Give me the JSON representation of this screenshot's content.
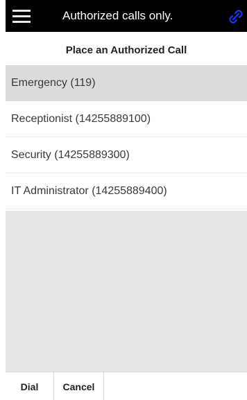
{
  "topbar": {
    "title": "Authorized calls only.",
    "menu_icon": "hamburger-menu-icon",
    "status_icon": "link-icon",
    "status_icon_color": "#1a3cff"
  },
  "subheader": {
    "title": "Place an Authorized Call"
  },
  "contacts": [
    {
      "label": "Emergency (119)",
      "selected": true
    },
    {
      "label": "Receptionist (14255889100)",
      "selected": false
    },
    {
      "label": "Security (14255889300)",
      "selected": false
    },
    {
      "label": "IT Administrator (14255889400)",
      "selected": false
    }
  ],
  "actions": {
    "dial_label": "Dial",
    "cancel_label": "Cancel"
  },
  "colors": {
    "topbar_bg": "#000000",
    "selected_bg": "#dcdcdc",
    "empty_bg": "#e6e6e6"
  }
}
